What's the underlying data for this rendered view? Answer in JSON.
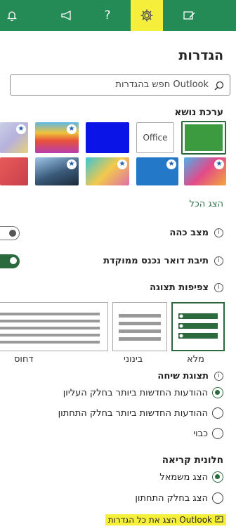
{
  "settings_title": "הגדרות",
  "search": {
    "placeholder": "חפש בהגדרות Outlook"
  },
  "theme": {
    "label": "ערכת נושא",
    "office_thumb_label": "Office",
    "show_all": "הצג הכל"
  },
  "dark_mode": {
    "label": "מצב כהה",
    "info": "i",
    "on": false
  },
  "focused_inbox": {
    "label": "תיבת דואר נכנס ממוקדת",
    "info": "i",
    "on": true
  },
  "density": {
    "label": "צפיפות תצוגה",
    "info": "i",
    "options": [
      "מלא",
      "בינוני",
      "דחוס"
    ],
    "selected": "מלא"
  },
  "conversation_view": {
    "label": "תצוגת שיחה",
    "info": "i",
    "options": [
      "ההודעות החדשות ביותר בחלק העליון",
      "ההודעות החדשות ביותר בחלק התחתון",
      "כבוי"
    ],
    "selected_index": 0
  },
  "reading_pane": {
    "label": "חלונית קריאה",
    "options": [
      "הצג משמאל",
      "הצג בחלק התחתון"
    ],
    "selected_index": 0
  },
  "footer_link": "הצג את כל הגדרות Outlook",
  "colors": {
    "topbar": "#258b56",
    "accent": "#2b6a3d",
    "highlight": "#f5ee3a"
  }
}
